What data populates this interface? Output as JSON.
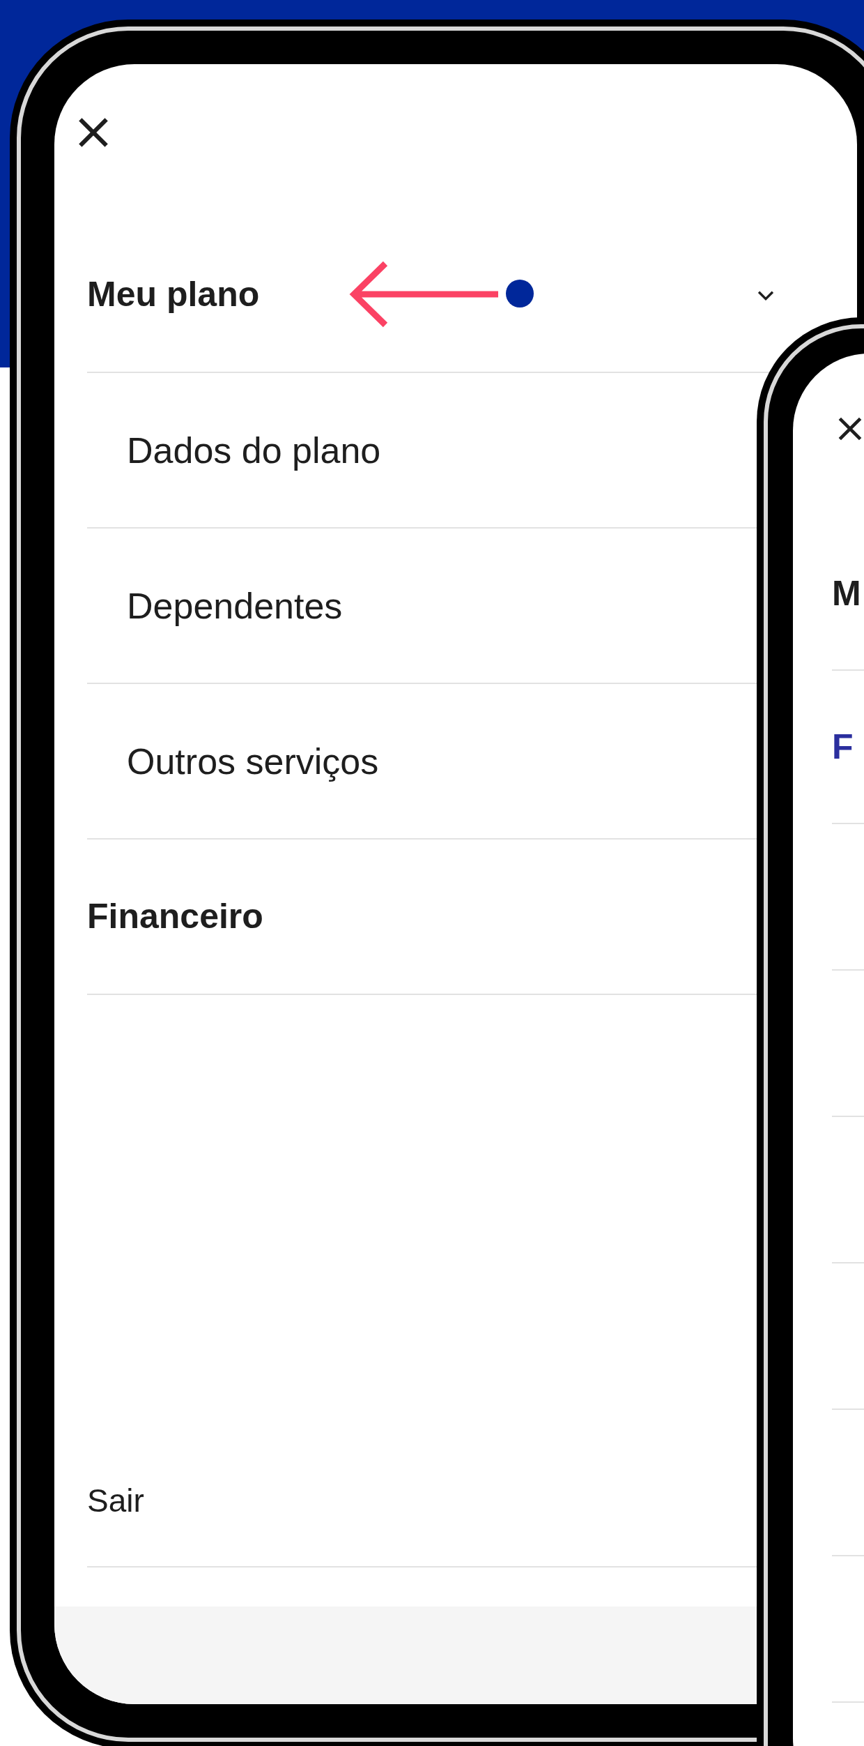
{
  "phone_main": {
    "menu": [
      {
        "label": "Meu plano",
        "children": [
          {
            "label": "Dados do plano"
          },
          {
            "label": "Dependentes"
          },
          {
            "label": "Outros serviços"
          }
        ]
      },
      {
        "label": "Financeiro"
      }
    ],
    "logout": "Sair"
  },
  "phone_second": {
    "menu": [
      {
        "label": "M",
        "selected": false
      },
      {
        "label": "F",
        "selected": true
      }
    ]
  }
}
